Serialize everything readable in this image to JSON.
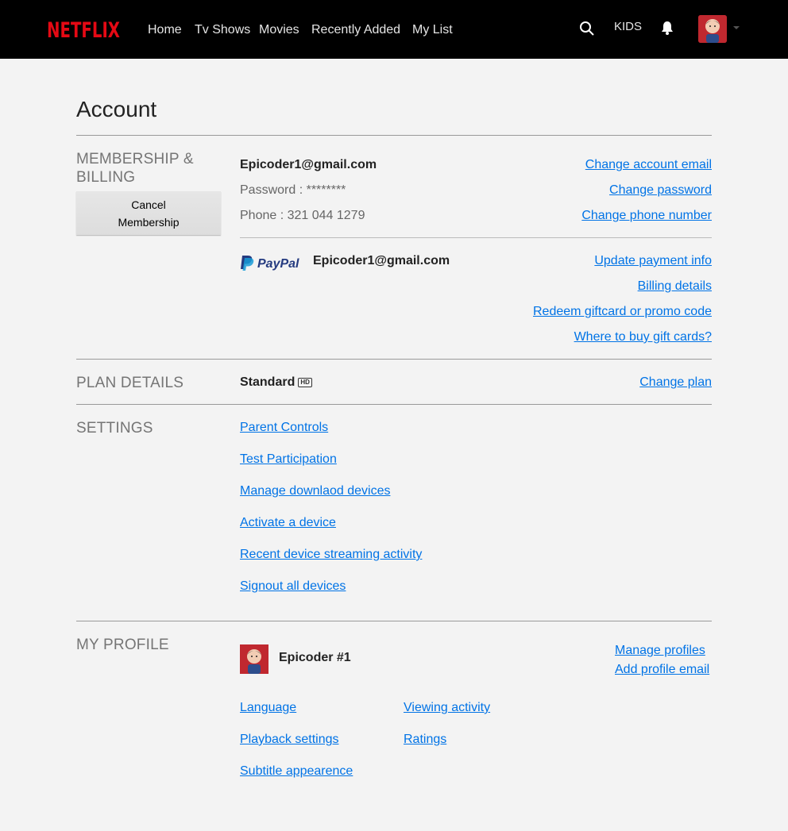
{
  "header": {
    "logo": "NETFLIX",
    "nav": [
      "Home",
      "Tv Shows",
      "Movies",
      "Recently Added",
      "My List"
    ],
    "kids": "KIDS"
  },
  "page": {
    "title": "Account"
  },
  "membership": {
    "label_line1": "MEMBERSHIP &",
    "label_line2": "BILLING",
    "cancel_line1": "Cancel",
    "cancel_line2": "Membership",
    "email": "Epicoder1@gmail.com",
    "password": "Password : ********",
    "phone": "Phone : 321 044 1279",
    "links": {
      "change_email": "Change account email",
      "change_password": "Change password",
      "change_phone": "Change phone number"
    },
    "payment_brand": "PayPal",
    "payment_email": "Epicoder1@gmail.com",
    "payment_links": {
      "update": "Update payment info",
      "billing": "Billing details",
      "redeem": "Redeem giftcard or promo code",
      "buy": "Where to buy gift cards?"
    }
  },
  "plan": {
    "label": "PLAN DETAILS",
    "name": "Standard",
    "badge": "HD",
    "change": "Change plan"
  },
  "settings": {
    "label": "SETTINGS",
    "items": [
      "Parent Controls",
      "Test Participation",
      "Manage downlaod devices",
      "Activate a device",
      "Recent device streaming activity",
      "Signout all devices"
    ]
  },
  "profile": {
    "label": "MY PROFILE",
    "name": "Epicoder #1",
    "manage": "Manage profiles",
    "add_email": "Add profile email",
    "links_left": [
      "Language",
      "Playback settings",
      "Subtitle appearence"
    ],
    "links_right": [
      "Viewing activity",
      "Ratings"
    ]
  },
  "colors": {
    "brand": "#e50914",
    "link": "#0073e6",
    "header_bg": "#000000"
  }
}
